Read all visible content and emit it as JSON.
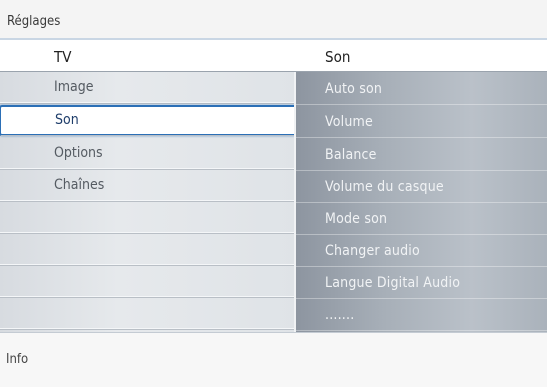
{
  "title": "Réglages",
  "header": {
    "left": "TV",
    "right": "Son"
  },
  "left_menu": {
    "items": [
      {
        "label": "Image"
      },
      {
        "label": "Son"
      },
      {
        "label": "Options"
      },
      {
        "label": "Chaînes"
      },
      {
        "label": ""
      },
      {
        "label": ""
      },
      {
        "label": ""
      },
      {
        "label": ""
      }
    ],
    "selected": "Son"
  },
  "right_menu": {
    "items": [
      {
        "label": "Auto son"
      },
      {
        "label": "Volume"
      },
      {
        "label": "Balance"
      },
      {
        "label": "Volume du casque"
      },
      {
        "label": "Mode son"
      },
      {
        "label": "Changer audio"
      },
      {
        "label": "Langue Digital Audio"
      },
      {
        "label": "......."
      }
    ]
  },
  "info": "Info",
  "colors": {
    "highlight_border": "#2b6fb6",
    "right_panel": "#a7afb8",
    "left_panel": "#e0e4e8"
  }
}
